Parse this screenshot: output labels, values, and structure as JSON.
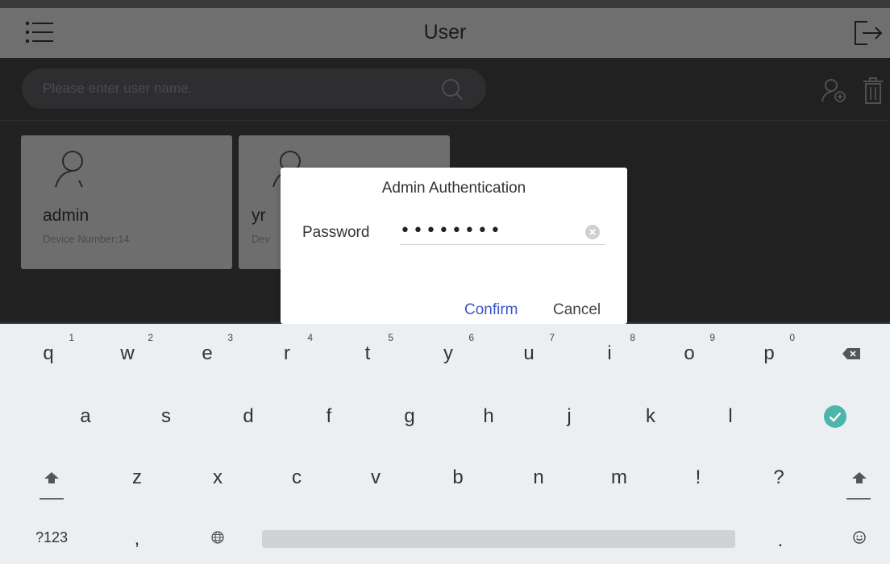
{
  "header": {
    "title": "User"
  },
  "toolbar": {
    "search_placeholder": "Please enter user name."
  },
  "users": [
    {
      "name": "admin",
      "device": "Device Number:14"
    },
    {
      "name": "yr",
      "device": "Dev"
    }
  ],
  "dialog": {
    "title": "Admin Authentication",
    "password_label": "Password",
    "password_value": "••••••••",
    "confirm_label": "Confirm",
    "cancel_label": "Cancel"
  },
  "keyboard": {
    "row1": [
      {
        "key": "q",
        "hint": "1"
      },
      {
        "key": "w",
        "hint": "2"
      },
      {
        "key": "e",
        "hint": "3"
      },
      {
        "key": "r",
        "hint": "4"
      },
      {
        "key": "t",
        "hint": "5"
      },
      {
        "key": "y",
        "hint": "6"
      },
      {
        "key": "u",
        "hint": "7"
      },
      {
        "key": "i",
        "hint": "8"
      },
      {
        "key": "o",
        "hint": "9"
      },
      {
        "key": "p",
        "hint": "0"
      }
    ],
    "row2": [
      "a",
      "s",
      "d",
      "f",
      "g",
      "h",
      "j",
      "k",
      "l"
    ],
    "row3": [
      "z",
      "x",
      "c",
      "v",
      "b",
      "n",
      "m",
      "!",
      "?"
    ],
    "symbols_label": "?123",
    "comma_label": ",",
    "period_label": ".",
    "icons": {
      "backspace": "backspace-icon",
      "enter": "check-circle-icon",
      "shift": "shift-arrow-icon",
      "language": "globe-icon",
      "emoji": "emoji-icon"
    },
    "accent_color": "#4db6ac"
  }
}
